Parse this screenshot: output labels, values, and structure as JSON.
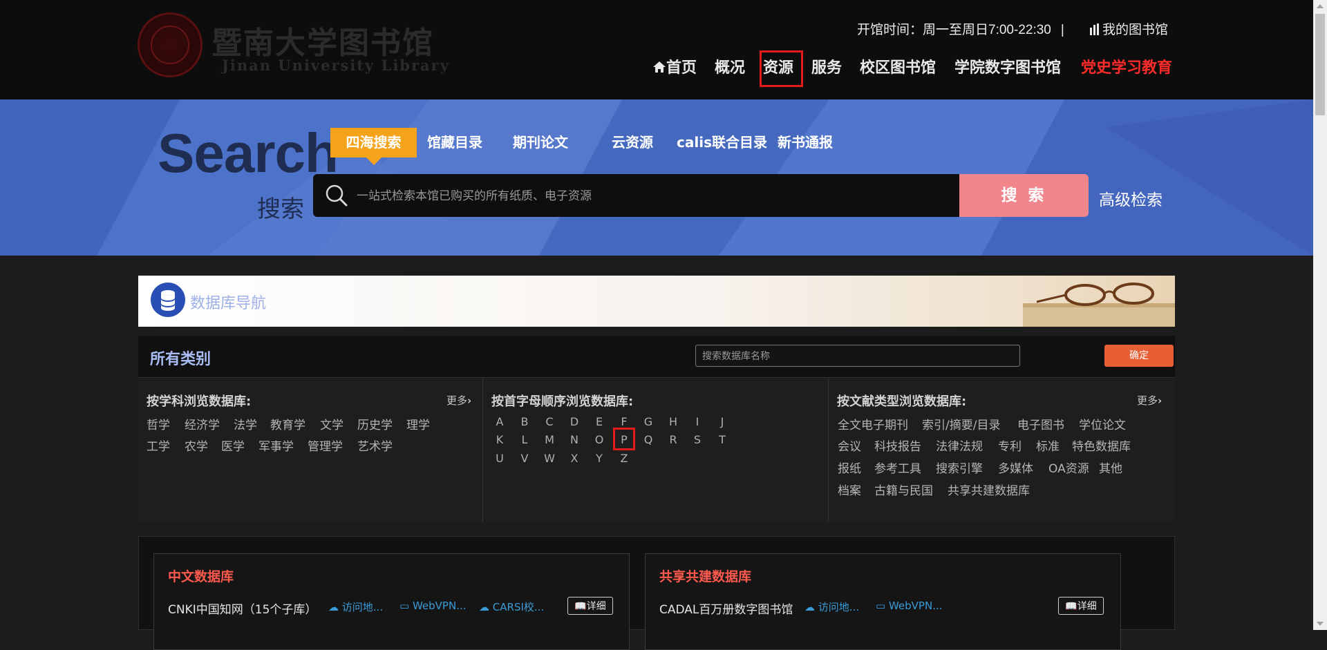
{
  "header": {
    "logo_text_cn": "暨南大学图书馆",
    "logo_text_en": "Jinan University Library",
    "opening_hours": "开馆时间：周一至周日7:00-22:30",
    "separator": "|",
    "my_library": "我的图书馆",
    "nav": [
      {
        "label": "首页",
        "icon": "home-icon"
      },
      {
        "label": "概况"
      },
      {
        "label": "资源",
        "highlighted": true
      },
      {
        "label": "服务"
      },
      {
        "label": "校区图书馆"
      },
      {
        "label": "学院数字图书馆"
      },
      {
        "label": "党史学习教育",
        "color": "#ff2a2a"
      }
    ]
  },
  "search": {
    "title_en": "Search",
    "title_cn": "搜索",
    "tabs": [
      "四海搜索",
      "馆藏目录",
      "期刊论文",
      "云资源",
      "calis联合目录",
      "新书通报"
    ],
    "active_tab": "四海搜索",
    "placeholder": "一站式检索本馆已购买的所有纸质、电子资源",
    "button": "搜 索",
    "advanced": "高级检索"
  },
  "db_nav": {
    "title": "数据库导航"
  },
  "categories": {
    "title": "所有类别",
    "search_placeholder": "搜索数据库名称",
    "confirm": "确定",
    "by_subject": {
      "title": "按学科浏览数据库:",
      "more": "更多",
      "items": [
        "哲学",
        "经济学",
        "法学",
        "教育学",
        "文学",
        "历史学",
        "理学",
        "工学",
        "农学",
        "医学",
        "军事学",
        "管理学",
        "艺术学"
      ]
    },
    "by_letter": {
      "title": "按首字母顺序浏览数据库:",
      "letters": [
        "A",
        "B",
        "C",
        "D",
        "E",
        "F",
        "G",
        "H",
        "I",
        "J",
        "K",
        "L",
        "M",
        "N",
        "O",
        "P",
        "Q",
        "R",
        "S",
        "T",
        "U",
        "V",
        "W",
        "X",
        "Y",
        "Z"
      ],
      "highlighted": "P"
    },
    "by_type": {
      "title": "按文献类型浏览数据库:",
      "more": "更多",
      "items": [
        "全文电子期刊",
        "索引/摘要/目录",
        "电子图书",
        "学位论文",
        "会议",
        "科技报告",
        "法律法规",
        "专利",
        "标准",
        "特色数据库",
        "报纸",
        "参考工具",
        "搜索引擎",
        "多媒体",
        "OA资源",
        "其他",
        "档案",
        "古籍与民国",
        "共享共建数据库"
      ]
    }
  },
  "databases": [
    {
      "title": "中文数据库",
      "name": "CNKI中国知网（15个子库）",
      "links": [
        "访问地...",
        "WebVPN...",
        "CARSI校..."
      ],
      "detail": "详细"
    },
    {
      "title": "共享共建数据库",
      "name": "CADAL百万册数字图书馆",
      "links": [
        "访问地...",
        "WebVPN..."
      ],
      "detail": "详细"
    }
  ],
  "colors": {
    "accent_orange": "#f5a31a",
    "search_band": "#4a6ec5",
    "search_button": "#f0868b",
    "confirm_button": "#e85f35",
    "highlight_box": "#e31b1b",
    "db_title_red": "#ff5a4d",
    "link_blue": "#3a9bd8"
  }
}
